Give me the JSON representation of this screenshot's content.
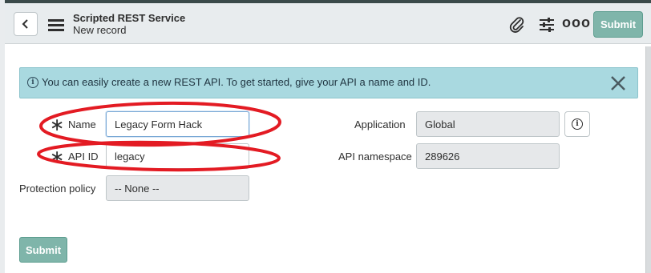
{
  "header": {
    "title": "Scripted REST Service",
    "subtitle": "New record",
    "submit_label": "Submit",
    "more_label": "ooo"
  },
  "banner": {
    "text": "You can easily create a new REST API. To get started, give your API a name and ID."
  },
  "form": {
    "name": {
      "label": "Name",
      "value": "Legacy Form Hack",
      "required": true
    },
    "api_id": {
      "label": "API ID",
      "value": "legacy",
      "required": true
    },
    "application": {
      "label": "Application",
      "value": "Global"
    },
    "api_namespace": {
      "label": "API namespace",
      "value": "289626"
    },
    "protection_policy": {
      "label": "Protection policy",
      "value": "-- None --"
    }
  },
  "footer": {
    "submit_label": "Submit"
  },
  "colors": {
    "submit_bg": "#7fb5aa",
    "banner_bg": "#a9d9e0",
    "annotation_red": "#e31b23"
  },
  "icons": [
    "back-icon",
    "menu-icon",
    "paperclip-icon",
    "sliders-icon",
    "more-icon",
    "info-icon",
    "close-icon",
    "required-asterisk-icon"
  ]
}
